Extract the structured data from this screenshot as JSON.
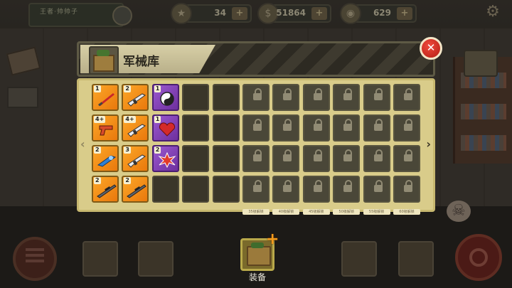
{
  "hud": {
    "player_name": "王者·帅帅子",
    "player_sub": "",
    "stars": "34",
    "cash": "51864",
    "gold": "629"
  },
  "dialog": {
    "title": "军械库",
    "close_symbol": "✕"
  },
  "inventory": {
    "items": [
      {
        "level": "1",
        "kind": "sword",
        "rarity": "orange",
        "row": 0,
        "col": 0
      },
      {
        "level": "2",
        "kind": "rifle",
        "rarity": "orange",
        "row": 0,
        "col": 1
      },
      {
        "level": "1",
        "kind": "yin-yang",
        "rarity": "purple",
        "row": 0,
        "col": 2
      },
      {
        "level": "4+",
        "kind": "pistol",
        "rarity": "orange",
        "row": 1,
        "col": 0
      },
      {
        "level": "4+",
        "kind": "rifle",
        "rarity": "orange",
        "row": 1,
        "col": 1
      },
      {
        "level": "1",
        "kind": "heart",
        "rarity": "purple",
        "row": 1,
        "col": 2
      },
      {
        "level": "2",
        "kind": "blaster",
        "rarity": "orange",
        "row": 2,
        "col": 0
      },
      {
        "level": "3",
        "kind": "rifle",
        "rarity": "orange",
        "row": 2,
        "col": 1
      },
      {
        "level": "2",
        "kind": "burst",
        "rarity": "purple",
        "row": 2,
        "col": 2
      },
      {
        "level": "2",
        "kind": "sniper",
        "rarity": "orange",
        "row": 3,
        "col": 0
      },
      {
        "level": "2",
        "kind": "sniper",
        "rarity": "orange",
        "row": 3,
        "col": 1
      }
    ],
    "unlock_tags": [
      "35级解锁",
      "40级解锁",
      "45级解锁",
      "50级解锁",
      "55级解锁",
      "60级解锁"
    ]
  },
  "nav": {
    "items": [
      {
        "label": "",
        "active": false
      },
      {
        "label": "",
        "active": false
      },
      {
        "label": "装备",
        "active": true
      },
      {
        "label": "",
        "active": false
      },
      {
        "label": "",
        "active": false
      }
    ]
  },
  "colors": {
    "panel": "#d9cc8a",
    "orange_slot": "#f59a1e",
    "purple_slot": "#8446b8",
    "close_button": "#d9352a"
  }
}
